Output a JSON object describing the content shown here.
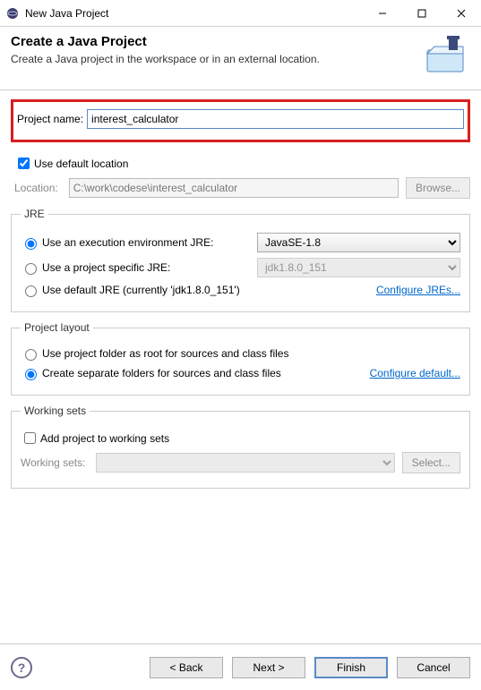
{
  "window": {
    "title": "New Java Project"
  },
  "header": {
    "title": "Create a Java Project",
    "subtitle": "Create a Java project in the workspace or in an external location."
  },
  "project": {
    "name_label": "Project name:",
    "name_value": "interest_calculator",
    "use_default_location_label": "Use default location",
    "use_default_location_checked": true,
    "location_label": "Location:",
    "location_value": "C:\\work\\codese\\interest_calculator",
    "browse_label": "Browse..."
  },
  "jre": {
    "legend": "JRE",
    "opt_exec_env_label": "Use an execution environment JRE:",
    "exec_env_value": "JavaSE-1.8",
    "opt_project_specific_label": "Use a project specific JRE:",
    "project_specific_value": "jdk1.8.0_151",
    "opt_default_label": "Use default JRE (currently 'jdk1.8.0_151')",
    "configure_link": "Configure JREs...",
    "selected": "exec_env"
  },
  "layout": {
    "legend": "Project layout",
    "opt_root_label": "Use project folder as root for sources and class files",
    "opt_separate_label": "Create separate folders for sources and class files",
    "configure_link": "Configure default...",
    "selected": "separate"
  },
  "working_sets": {
    "legend": "Working sets",
    "add_label": "Add project to working sets",
    "add_checked": false,
    "ws_label": "Working sets:",
    "select_label": "Select..."
  },
  "footer": {
    "back": "< Back",
    "next": "Next >",
    "finish": "Finish",
    "cancel": "Cancel"
  }
}
